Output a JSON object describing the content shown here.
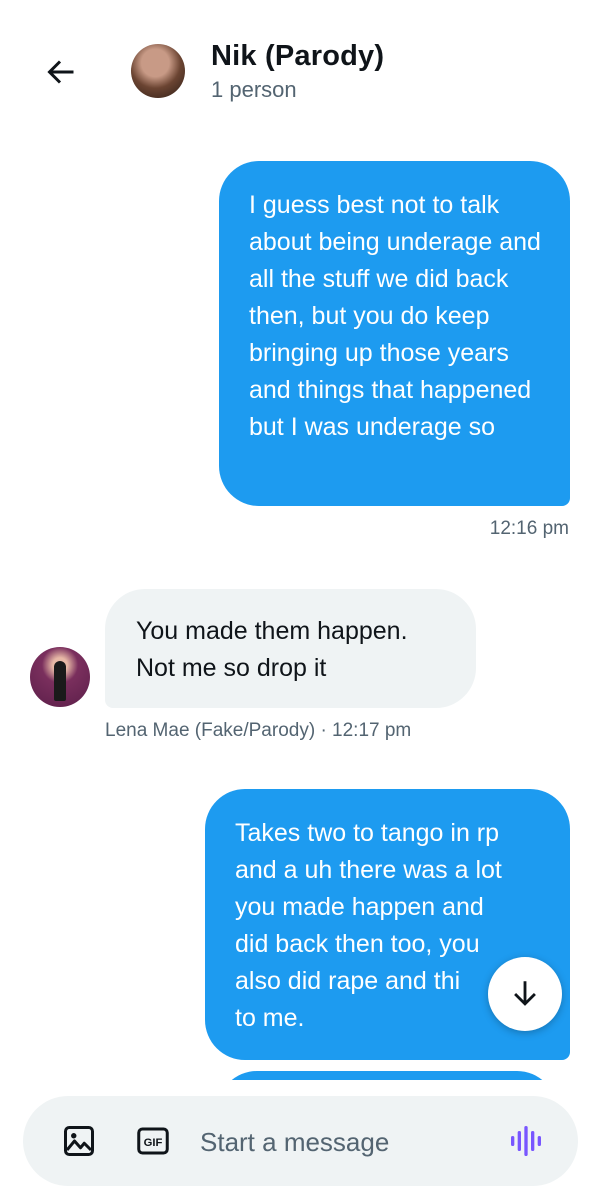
{
  "header": {
    "name": "Nik (Parody)",
    "subtitle": "1 person"
  },
  "messages": [
    {
      "direction": "sent",
      "text": "I guess best not to talk about being underage and all the stuff we did back then, but you do keep bringing up those years and things that happened  but I was underage so",
      "timestamp": "12:16 pm"
    },
    {
      "direction": "received",
      "text": "You made them happen.\nNot me so drop it",
      "sender_line": "Lena Mae (Fake/Parody) · 12:17 pm"
    },
    {
      "direction": "sent",
      "text": "Takes two to tango in rp\nand a uh there was a lot\nyou made happen and\ndid back then too, you\nalso did rape and thi\nto me."
    }
  ],
  "composer": {
    "placeholder": "Start a message",
    "gif_label": "GIF"
  },
  "colors": {
    "accent": "#1d9bf0",
    "received_bubble": "#eff3f4",
    "secondary_text": "#536471",
    "voice_icon": "#7856ff"
  },
  "icons": {
    "back": "arrow-left-icon",
    "scroll": "arrow-down-icon",
    "media": "image-icon",
    "gif": "gif-icon",
    "voice": "voice-wave-icon"
  }
}
